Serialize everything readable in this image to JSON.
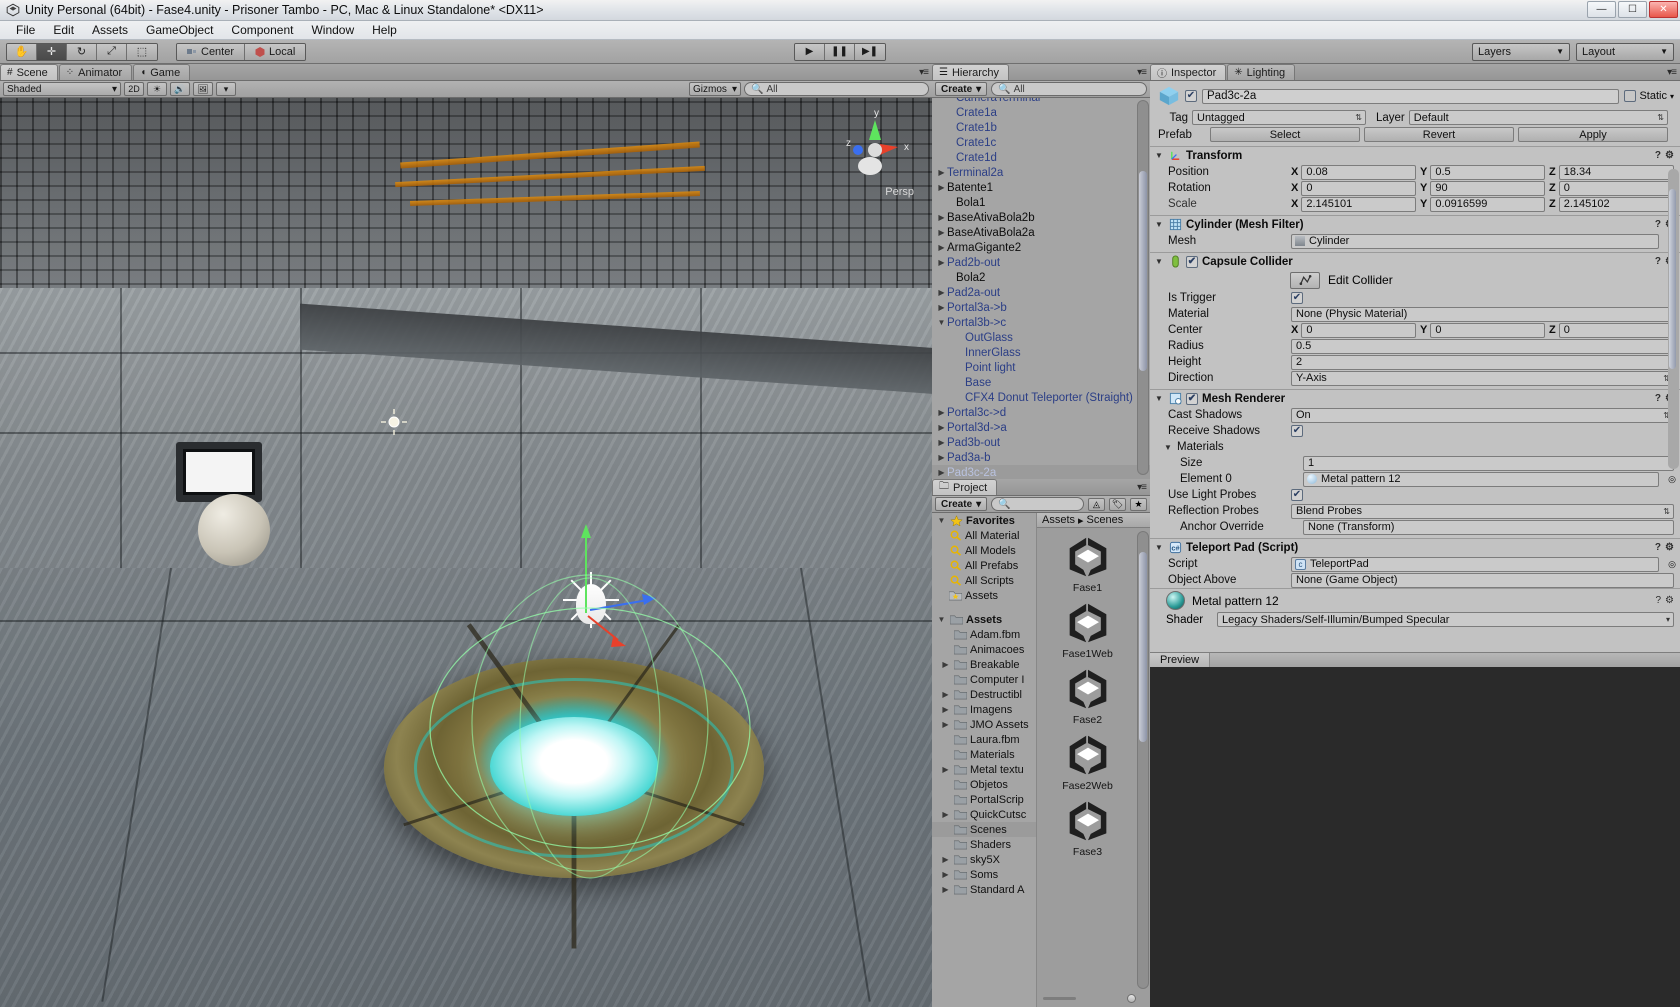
{
  "window": {
    "title": "Unity Personal (64bit) - Fase4.unity - Prisoner Tambo - PC, Mac & Linux Standalone* <DX11>",
    "minimize": "—",
    "maximize": "☐",
    "close": "✕"
  },
  "menu": [
    "File",
    "Edit",
    "Assets",
    "GameObject",
    "Component",
    "Window",
    "Help"
  ],
  "toolbar": {
    "tools": [
      {
        "name": "hand-tool",
        "glyph": "✋",
        "active": false
      },
      {
        "name": "move-tool",
        "glyph": "✛",
        "active": true
      },
      {
        "name": "rotate-tool",
        "glyph": "↻",
        "active": false
      },
      {
        "name": "scale-tool",
        "glyph": "⤢",
        "active": false
      },
      {
        "name": "rect-tool",
        "glyph": "⬚",
        "active": false
      }
    ],
    "pivot_label": "Center",
    "space_label": "Local",
    "play": "▶",
    "pause": "❚❚",
    "step": "▶❚",
    "layers_label": "Layers",
    "layout_label": "Layout"
  },
  "scene": {
    "tabs": [
      {
        "label": "Scene",
        "icon": "grid-icon",
        "active": true
      },
      {
        "label": "Animator",
        "icon": "animator-icon",
        "active": false
      },
      {
        "label": "Game",
        "icon": "gamepad-icon",
        "active": false
      }
    ],
    "draw_mode": "Shaded",
    "mode_2d": "2D",
    "gizmos_label": "Gizmos",
    "search_placeholder": "All",
    "axis": {
      "x": "x",
      "y": "y",
      "z": "z"
    },
    "persp_label": "Persp"
  },
  "hierarchy": {
    "tab_label": "Hierarchy",
    "create_label": "Create",
    "search_placeholder": "All",
    "items": [
      {
        "label": "CameraTerminal",
        "indent": 1,
        "arrow": false,
        "prefab": true,
        "clipped": true
      },
      {
        "label": "Crate1a",
        "indent": 1,
        "arrow": false,
        "prefab": true
      },
      {
        "label": "Crate1b",
        "indent": 1,
        "arrow": false,
        "prefab": true
      },
      {
        "label": "Crate1c",
        "indent": 1,
        "arrow": false,
        "prefab": true
      },
      {
        "label": "Crate1d",
        "indent": 1,
        "arrow": false,
        "prefab": true
      },
      {
        "label": "Terminal2a",
        "indent": 0,
        "arrow": true,
        "prefab": true
      },
      {
        "label": "Batente1",
        "indent": 0,
        "arrow": true,
        "prefab": false
      },
      {
        "label": "Bola1",
        "indent": 1,
        "arrow": false,
        "prefab": false
      },
      {
        "label": "BaseAtivaBola2b",
        "indent": 0,
        "arrow": true,
        "prefab": false
      },
      {
        "label": "BaseAtivaBola2a",
        "indent": 0,
        "arrow": true,
        "prefab": false
      },
      {
        "label": "ArmaGigante2",
        "indent": 0,
        "arrow": true,
        "prefab": false
      },
      {
        "label": "Pad2b-out",
        "indent": 0,
        "arrow": true,
        "prefab": true
      },
      {
        "label": "Bola2",
        "indent": 1,
        "arrow": false,
        "prefab": false
      },
      {
        "label": "Pad2a-out",
        "indent": 0,
        "arrow": true,
        "prefab": true
      },
      {
        "label": "Portal3a->b",
        "indent": 0,
        "arrow": true,
        "prefab": true
      },
      {
        "label": "Portal3b->c",
        "indent": 0,
        "arrow": "down",
        "prefab": true
      },
      {
        "label": "OutGlass",
        "indent": 2,
        "arrow": false,
        "prefab": true
      },
      {
        "label": "InnerGlass",
        "indent": 2,
        "arrow": false,
        "prefab": true
      },
      {
        "label": "Point light",
        "indent": 2,
        "arrow": false,
        "prefab": true
      },
      {
        "label": "Base",
        "indent": 2,
        "arrow": false,
        "prefab": true
      },
      {
        "label": "CFX4 Donut Teleporter (Straight)",
        "indent": 2,
        "arrow": false,
        "prefab": true
      },
      {
        "label": "Portal3c->d",
        "indent": 0,
        "arrow": true,
        "prefab": true
      },
      {
        "label": "Portal3d->a",
        "indent": 0,
        "arrow": true,
        "prefab": true
      },
      {
        "label": "Pad3b-out",
        "indent": 0,
        "arrow": true,
        "prefab": true
      },
      {
        "label": "Pad3a-b",
        "indent": 0,
        "arrow": true,
        "prefab": true
      },
      {
        "label": "Pad3c-2a",
        "indent": 0,
        "arrow": true,
        "prefab": true,
        "selected": true
      }
    ]
  },
  "project": {
    "tab_label": "Project",
    "create_label": "Create",
    "search_placeholder": "",
    "favorites_label": "Favorites",
    "favorites": [
      "All Material",
      "All Models",
      "All Prefabs",
      "All Scripts",
      "Assets"
    ],
    "assets_label": "Assets",
    "folders": [
      {
        "label": "Adam.fbm",
        "arrow": false
      },
      {
        "label": "Animacoes",
        "arrow": false
      },
      {
        "label": "Breakable",
        "arrow": true
      },
      {
        "label": "Computer I",
        "arrow": false
      },
      {
        "label": "Destructibl",
        "arrow": true
      },
      {
        "label": "Imagens",
        "arrow": true
      },
      {
        "label": "JMO Assets",
        "arrow": true
      },
      {
        "label": "Laura.fbm",
        "arrow": false
      },
      {
        "label": "Materials",
        "arrow": false
      },
      {
        "label": "Metal textu",
        "arrow": true
      },
      {
        "label": "Objetos",
        "arrow": false
      },
      {
        "label": "PortalScrip",
        "arrow": false
      },
      {
        "label": "QuickCutsc",
        "arrow": true
      },
      {
        "label": "Scenes",
        "arrow": false,
        "selected": true
      },
      {
        "label": "Shaders",
        "arrow": false
      },
      {
        "label": "sky5X",
        "arrow": true
      },
      {
        "label": "Soms",
        "arrow": true
      },
      {
        "label": "Standard A",
        "arrow": true
      }
    ],
    "breadcrumb": [
      "Assets",
      "Scenes"
    ],
    "assets_grid": [
      {
        "label": "Fase1"
      },
      {
        "label": "Fase1Web"
      },
      {
        "label": "Fase2"
      },
      {
        "label": "Fase2Web"
      },
      {
        "label": "Fase3"
      }
    ]
  },
  "inspector": {
    "tabs": [
      {
        "label": "Inspector",
        "active": true
      },
      {
        "label": "Lighting",
        "active": false
      }
    ],
    "object_name": "Pad3c-2a",
    "enabled": true,
    "static_label": "Static",
    "tag_label": "Tag",
    "tag_value": "Untagged",
    "layer_label": "Layer",
    "layer_value": "Default",
    "prefab_label": "Prefab",
    "prefab_buttons": [
      "Select",
      "Revert",
      "Apply"
    ],
    "components": [
      {
        "name": "Transform",
        "icon": "transform-icon",
        "rows": [
          {
            "label": "Position",
            "type": "vec3",
            "x": "0.08",
            "y": "0.5",
            "z": "18.34"
          },
          {
            "label": "Rotation",
            "type": "vec3",
            "x": "0",
            "y": "90",
            "z": "0"
          },
          {
            "label": "Scale",
            "type": "vec3",
            "x": "2.145101",
            "y": "0.0916599",
            "z": "2.145102",
            "dim": true
          }
        ]
      },
      {
        "name": "Cylinder (Mesh Filter)",
        "icon": "mesh-filter-icon",
        "rows": [
          {
            "label": "Mesh",
            "type": "object",
            "value": "Cylinder",
            "icon": "mesh-icon"
          }
        ]
      },
      {
        "name": "Capsule Collider",
        "icon": "collider-icon",
        "checkbox": true,
        "edit_collider_label": "Edit Collider",
        "rows": [
          {
            "label": "Is Trigger",
            "type": "check",
            "value": true
          },
          {
            "label": "Material",
            "type": "text",
            "value": "None (Physic Material)"
          },
          {
            "label": "Center",
            "type": "vec3",
            "x": "0",
            "y": "0",
            "z": "0"
          },
          {
            "label": "Radius",
            "type": "text",
            "value": "0.5"
          },
          {
            "label": "Height",
            "type": "text",
            "value": "2"
          },
          {
            "label": "Direction",
            "type": "dropdown",
            "value": "Y-Axis"
          }
        ]
      },
      {
        "name": "Mesh Renderer",
        "icon": "mesh-renderer-icon",
        "checkbox": true,
        "rows": [
          {
            "label": "Cast Shadows",
            "type": "dropdown",
            "value": "On"
          },
          {
            "label": "Receive Shadows",
            "type": "check",
            "value": true
          },
          {
            "label": "Materials",
            "type": "fold"
          },
          {
            "label": "Size",
            "type": "text",
            "value": "1",
            "sub": true
          },
          {
            "label": "Element 0",
            "type": "object",
            "value": "Metal pattern 12",
            "icon": "material-icon",
            "sub": true
          },
          {
            "label": "Use Light Probes",
            "type": "check",
            "value": true
          },
          {
            "label": "Reflection Probes",
            "type": "dropdown",
            "value": "Blend Probes"
          },
          {
            "label": "Anchor Override",
            "type": "text",
            "value": "None (Transform)",
            "sub": true
          }
        ]
      },
      {
        "name": "Teleport Pad (Script)",
        "icon": "script-icon",
        "rows": [
          {
            "label": "Script",
            "type": "object",
            "value": "TeleportPad",
            "icon": "script-icon"
          },
          {
            "label": "Object Above",
            "type": "text",
            "value": "None (Game Object)"
          }
        ]
      }
    ],
    "material_name": "Metal pattern 12",
    "shader_label": "Shader",
    "shader_value": "Legacy Shaders/Self-Illumin/Bumped Specular",
    "preview_label": "Preview"
  },
  "colors": {
    "prefab_blue": "#2b3e86",
    "panel_bg": "#c2c2c2",
    "accent_teal": "#2fd3cf"
  }
}
